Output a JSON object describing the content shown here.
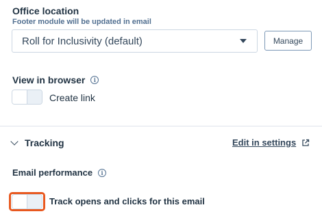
{
  "office_location": {
    "title": "Office location",
    "subtitle": "Footer module will be updated in email",
    "selected_value": "Roll for Inclusivity (default)",
    "manage_label": "Manage"
  },
  "view_in_browser": {
    "title": "View in browser",
    "toggle_label": "Create link",
    "enabled": false
  },
  "tracking": {
    "section_title": "Tracking",
    "edit_link": "Edit in settings",
    "expanded": true
  },
  "email_performance": {
    "title": "Email performance",
    "toggle_label": "Track opens and clicks for this email",
    "enabled": false,
    "highlight_color": "#e8581f"
  },
  "icons": {
    "info": "i",
    "external": "external-link-icon"
  }
}
